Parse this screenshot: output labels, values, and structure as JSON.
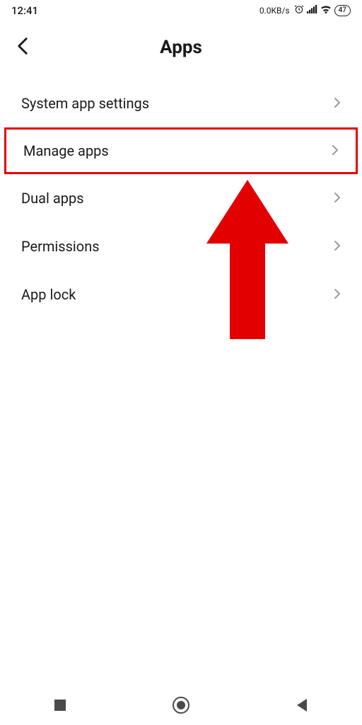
{
  "status": {
    "time": "12:41",
    "net_speed": "0.0KB/s",
    "battery": "47"
  },
  "header": {
    "title": "Apps"
  },
  "menu": {
    "items": [
      {
        "label": "System app settings"
      },
      {
        "label": "Manage apps"
      },
      {
        "label": "Dual apps"
      },
      {
        "label": "Permissions"
      },
      {
        "label": "App lock"
      }
    ]
  },
  "annotation": {
    "highlight_index": 1,
    "arrow_color": "#e30000"
  }
}
